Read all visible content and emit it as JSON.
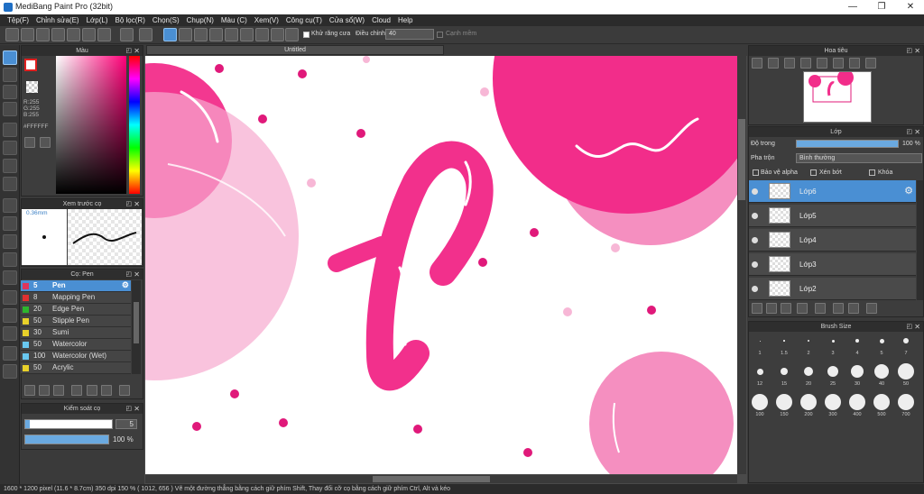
{
  "app": {
    "title": "MediBang Paint Pro (32bit)"
  },
  "menu": [
    "Tệp(F)",
    "Chỉnh sửa(E)",
    "Lớp(L)",
    "Bộ lọc(R)",
    "Chọn(S)",
    "Chụp(N)",
    "Màu (C)",
    "Xem(V)",
    "Công cụ(T)",
    "Cửa sổ(W)",
    "Cloud",
    "Help"
  ],
  "toolbar": {
    "antialias_label": "Khử răng cưa",
    "adjust_label": "Điều chỉnh",
    "adjust_value": "40",
    "smooth_label": "Cạnh mềm"
  },
  "color_panel": {
    "title": "Màu",
    "r": "R:255",
    "g": "G:255",
    "b": "B:255",
    "hex": "#FFFFFF",
    "accent": "#ff0078"
  },
  "preview_panel": {
    "title": "Xem trước cọ",
    "size": "0.36mm"
  },
  "brush_panel": {
    "title": "Cọ: Pen",
    "brushes": [
      {
        "size": "5",
        "name": "Pen",
        "color": "#e0355a"
      },
      {
        "size": "8",
        "name": "Mapping Pen",
        "color": "#e03030"
      },
      {
        "size": "20",
        "name": "Edge Pen",
        "color": "#2db52d"
      },
      {
        "size": "50",
        "name": "Stipple Pen",
        "color": "#e8d12a"
      },
      {
        "size": "30",
        "name": "Sumi",
        "color": "#e8d12a"
      },
      {
        "size": "50",
        "name": "Watercolor",
        "color": "#69c8f0"
      },
      {
        "size": "100",
        "name": "Watercolor (Wet)",
        "color": "#69c8f0"
      },
      {
        "size": "50",
        "name": "Acrylic",
        "color": "#e8d12a"
      }
    ]
  },
  "control_panel": {
    "title": "Kiểm soát cọ",
    "size_value": "5",
    "opacity_value": "100 %",
    "size_fraction": 0.05,
    "opacity_fraction": 1.0
  },
  "canvas": {
    "tab_title": "Untitled"
  },
  "navigator": {
    "title": "Hoa tiêu"
  },
  "layer_panel": {
    "title": "Lớp",
    "opacity_label": "Độ trong",
    "opacity_value": "100 %",
    "blend_label": "Pha trộn",
    "blend_value": "Bình thường",
    "protect_alpha": "Bảo vệ alpha",
    "clipping": "Xén bớt",
    "lock": "Khóa",
    "layers": [
      "Lớp6",
      "Lớp5",
      "Lớp4",
      "Lớp3",
      "Lớp2"
    ]
  },
  "brush_size_panel": {
    "title": "Brush Size",
    "sizes": [
      "1",
      "1.5",
      "2",
      "3",
      "4",
      "5",
      "7",
      "12",
      "15",
      "20",
      "25",
      "30",
      "40",
      "50",
      "100",
      "150",
      "200",
      "300",
      "400",
      "500",
      "700"
    ]
  },
  "status": {
    "text": "1600 * 1200 pixel   (11.6 * 8.7cm)   350 dpi   150 %   ( 1012, 656 )   Vẽ một đường thẳng bằng cách giữ phím Shift, Thay đổi cỡ cọ bằng cách giữ phím Ctrl, Alt và kéo"
  }
}
